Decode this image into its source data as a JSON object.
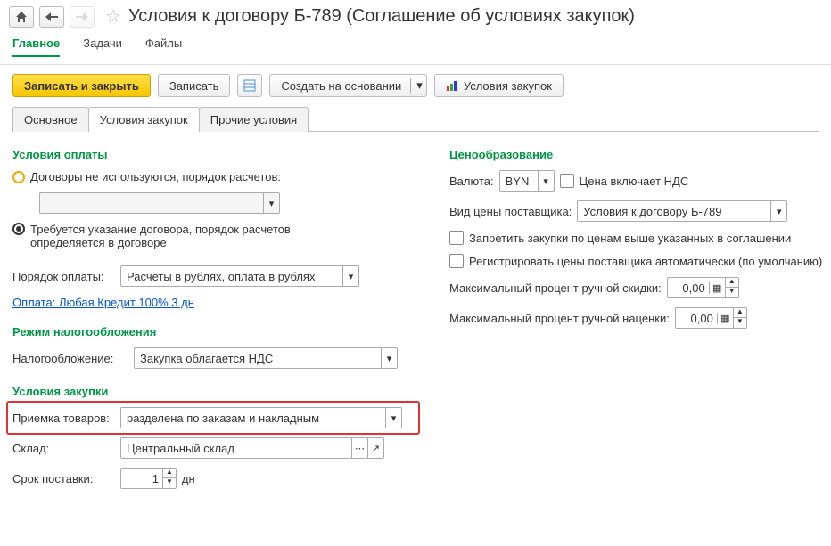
{
  "header": {
    "title": "Условия к договору Б-789 (Соглашение об условиях закупок)"
  },
  "menutabs": {
    "main": "Главное",
    "tasks": "Задачи",
    "files": "Файлы"
  },
  "toolbar": {
    "save_close": "Записать и закрыть",
    "save": "Записать",
    "create_based": "Создать на основании",
    "purchase_cond": "Условия закупок"
  },
  "ctabs": {
    "main": "Основное",
    "purchase": "Условия закупок",
    "other": "Прочие условия"
  },
  "pay": {
    "group": "Условия оплаты",
    "opt_no_contract": "Договоры не используются, порядок расчетов:",
    "opt_contract_req": "Требуется указание договора, порядок расчетов определяется в договоре",
    "order_label": "Порядок оплаты:",
    "order_value": "Расчеты в рублях, оплата в рублях",
    "payment_link": "Оплата: Любая Кредит 100% 3 дн"
  },
  "tax": {
    "group": "Режим налогообложения",
    "label": "Налогообложение:",
    "value": "Закупка облагается НДС"
  },
  "purch": {
    "group": "Условия закупки",
    "receipt_label": "Приемка товаров:",
    "receipt_value": "разделена по заказам и накладным",
    "warehouse_label": "Склад:",
    "warehouse_value": "Центральный склад",
    "term_label": "Срок поставки:",
    "term_value": "1",
    "term_unit": "дн"
  },
  "price": {
    "group": "Ценообразование",
    "currency_label": "Валюта:",
    "currency_value": "BYN",
    "vat_incl": "Цена включает НДС",
    "price_type_label": "Вид цены поставщика:",
    "price_type_value": "Условия к договору Б-789",
    "forbid_higher": "Запретить закупки по ценам выше указанных в соглашении",
    "auto_register": "Регистрировать цены поставщика автоматически (по умолчанию)",
    "max_disc_label": "Максимальный процент ручной скидки:",
    "max_disc_value": "0,00",
    "max_markup_label": "Максимальный процент ручной наценки:",
    "max_markup_value": "0,00"
  }
}
